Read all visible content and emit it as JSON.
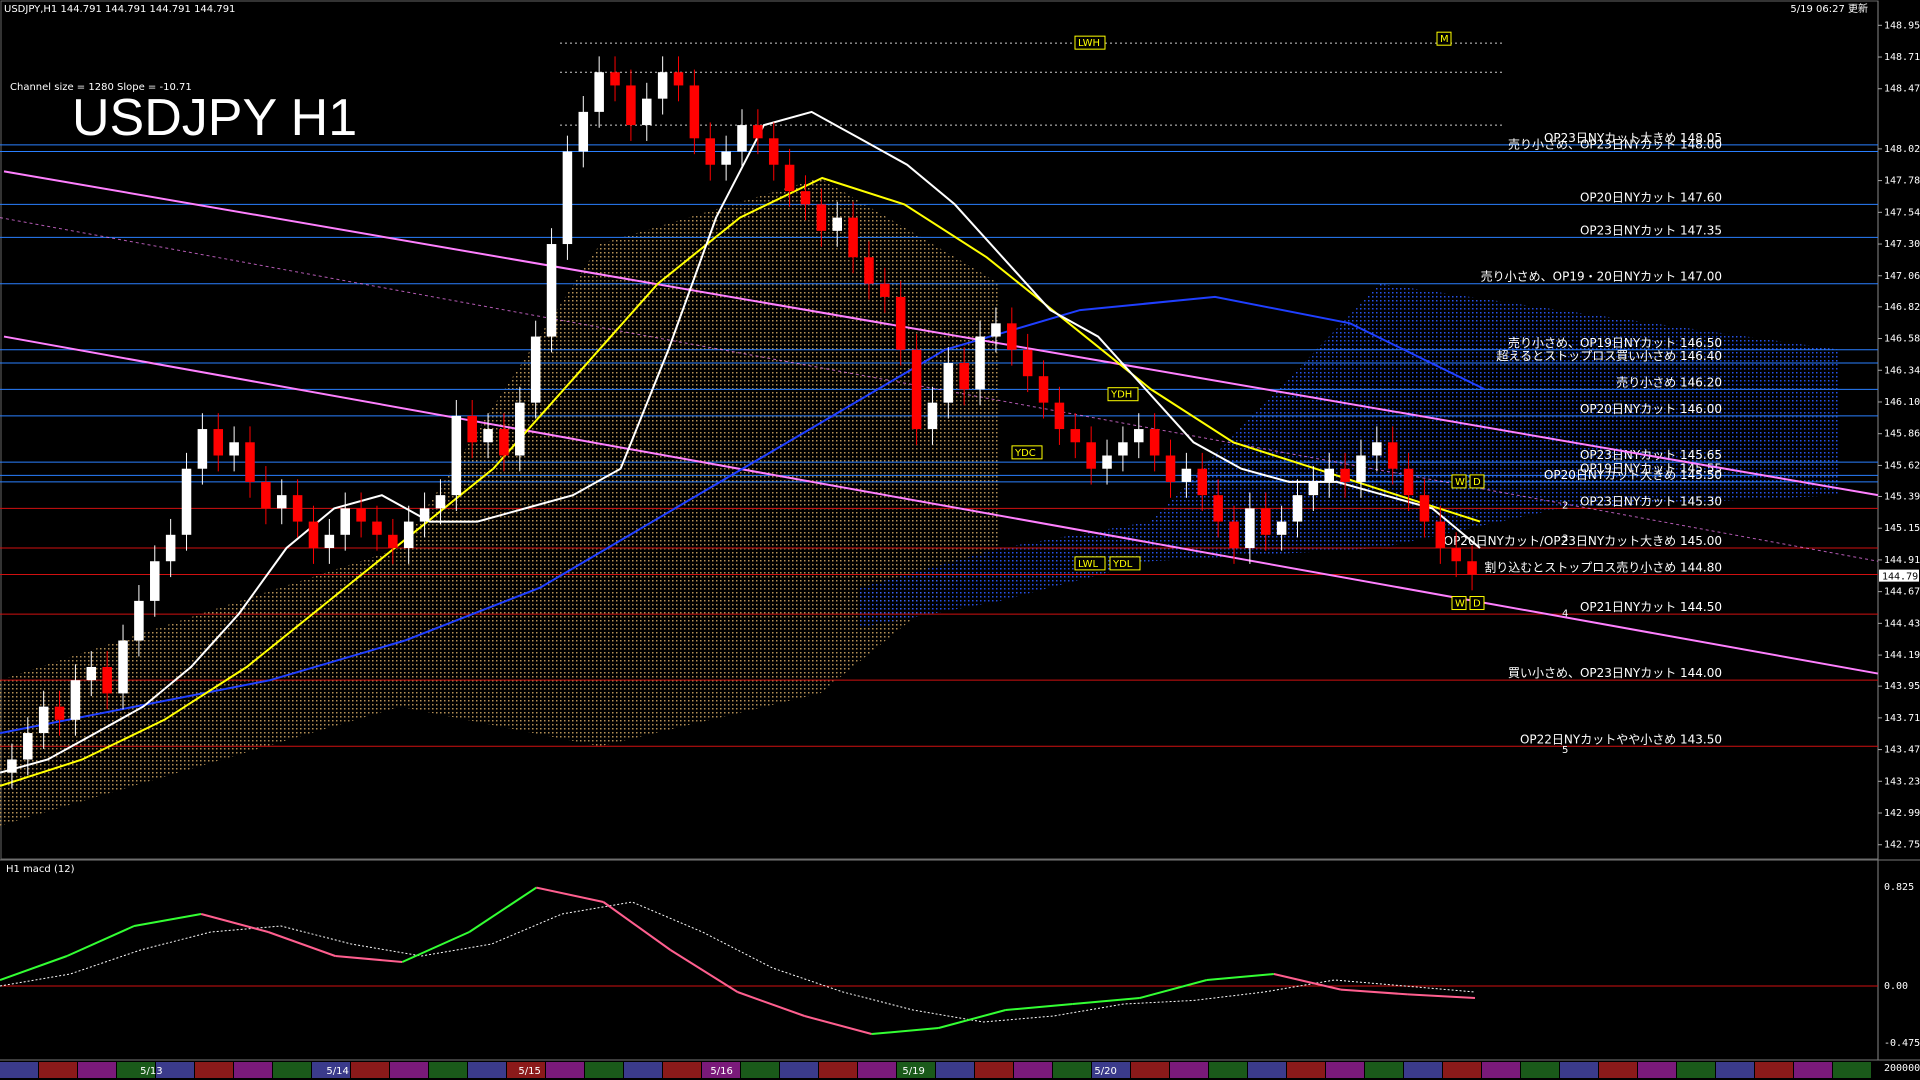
{
  "header": {
    "symbol_info": "USDJPY,H1  144.791 144.791 144.791 144.791",
    "updated": "5/19 06:27 更新",
    "channel_info": "Channel size = 1280 Slope = -10.71",
    "big_title": "USDJPY H1"
  },
  "colors": {
    "background": "#000000",
    "bull_candle": "#ffffff",
    "bear_candle": "#ff0000",
    "ma_white": "#ffffff",
    "ma_yellow": "#ffff00",
    "ma_blue": "#1f3fff",
    "channel": "#ff80ff",
    "cloud_lead_a": "#c8a060",
    "cloud_lead_b": "#2a5aff",
    "order_line_blue": "#2a7fff",
    "order_line_red": "#d01010",
    "macd_up": "#33ff33",
    "macd_down": "#ff5f8f",
    "bollinger": "#d01010",
    "chikou": "#22bb22"
  },
  "chart_data": {
    "type": "candlestick",
    "title": "USDJPY H1",
    "ylim": [
      142.7,
      148.98
    ],
    "y_ticks": [
      148.955,
      148.715,
      148.475,
      148.02,
      147.78,
      147.54,
      147.3,
      147.06,
      146.825,
      146.585,
      146.345,
      146.105,
      145.865,
      145.625,
      145.39,
      145.15,
      144.91,
      144.67,
      144.43,
      144.19,
      143.955,
      143.715,
      143.475,
      143.235,
      142.995,
      142.755
    ],
    "last_price": "144.791",
    "date_labels": [
      "5/13",
      "5/14",
      "5/15",
      "5/16",
      "5/19",
      "5/20"
    ],
    "date_positions": [
      0.058,
      0.155,
      0.255,
      0.355,
      0.455,
      0.555
    ],
    "candles_close": [
      143.4,
      143.6,
      143.8,
      143.7,
      144.0,
      144.1,
      143.9,
      144.3,
      144.6,
      144.9,
      145.1,
      145.6,
      145.9,
      145.7,
      145.8,
      145.5,
      145.3,
      145.4,
      145.2,
      145.0,
      145.1,
      145.3,
      145.2,
      145.1,
      145.0,
      145.2,
      145.3,
      145.4,
      146.0,
      145.8,
      145.9,
      145.7,
      146.1,
      146.6,
      147.3,
      148.0,
      148.3,
      148.6,
      148.5,
      148.2,
      148.4,
      148.6,
      148.5,
      148.1,
      147.9,
      148.0,
      148.2,
      148.1,
      147.9,
      147.7,
      147.6,
      147.4,
      147.5,
      147.2,
      147.0,
      146.9,
      146.5,
      145.9,
      146.1,
      146.4,
      146.2,
      146.6,
      146.7,
      146.5,
      146.3,
      146.1,
      145.9,
      145.8,
      145.6,
      145.7,
      145.8,
      145.9,
      145.7,
      145.5,
      145.6,
      145.4,
      145.2,
      145.0,
      145.3,
      145.1,
      145.2,
      145.4,
      145.5,
      145.6,
      145.5,
      145.7,
      145.8,
      145.6,
      145.4,
      145.2,
      145.0,
      144.9,
      144.8
    ],
    "ma_white": [
      143.3,
      143.4,
      143.6,
      143.8,
      144.1,
      144.5,
      145.0,
      145.3,
      145.4,
      145.2,
      145.2,
      145.3,
      145.4,
      145.6,
      146.5,
      147.5,
      148.2,
      148.3,
      148.1,
      147.9,
      147.6,
      147.2,
      146.8,
      146.6,
      146.2,
      145.8,
      145.6,
      145.5,
      145.5,
      145.4,
      145.3,
      145.0
    ],
    "ma_yellow": [
      143.2,
      143.4,
      143.7,
      144.1,
      144.6,
      145.1,
      145.6,
      146.3,
      147.0,
      147.5,
      147.8,
      147.6,
      147.2,
      146.7,
      146.2,
      145.8,
      145.6,
      145.4,
      145.2
    ],
    "ma_blue": [
      143.6,
      143.8,
      144.0,
      144.3,
      144.7,
      145.3,
      145.9,
      146.5,
      146.8,
      146.9,
      146.7,
      146.2
    ],
    "macd": [
      0.05,
      0.25,
      0.5,
      0.6,
      0.45,
      0.25,
      0.2,
      0.45,
      0.82,
      0.7,
      0.3,
      -0.05,
      -0.25,
      -0.4,
      -0.35,
      -0.2,
      -0.15,
      -0.1,
      0.05,
      0.1,
      -0.03,
      -0.07,
      -0.1
    ],
    "macd_signal": [
      0.0,
      0.1,
      0.3,
      0.45,
      0.5,
      0.35,
      0.25,
      0.35,
      0.6,
      0.7,
      0.45,
      0.15,
      -0.05,
      -0.2,
      -0.3,
      -0.25,
      -0.15,
      -0.12,
      -0.05,
      0.05,
      0.0,
      -0.05
    ],
    "macd_label": "H1  macd (12)",
    "macd_ticks": [
      "0.825",
      "0.00",
      "-0.475",
      "200000"
    ],
    "channel_lines": [
      {
        "from": [
          0.0,
          147.85
        ],
        "to": [
          1.0,
          145.4
        ]
      },
      {
        "from": [
          0.0,
          146.6
        ],
        "to": [
          1.0,
          144.05
        ]
      }
    ],
    "order_levels": [
      {
        "price": 148.05,
        "label": "OP23日NYカット大きめ 148.05",
        "color": "blue"
      },
      {
        "price": 148.0,
        "label": "売り小さめ、OP23日NYカット 148.00",
        "color": "blue"
      },
      {
        "price": 147.6,
        "label": "OP20日NYカット 147.60",
        "color": "blue"
      },
      {
        "price": 147.35,
        "label": "OP23日NYカット 147.35",
        "color": "blue"
      },
      {
        "price": 147.0,
        "label": "売り小さめ、OP19・20日NYカット 147.00",
        "color": "blue"
      },
      {
        "price": 146.5,
        "label": "売り小さめ、OP19日NYカット 146.50",
        "color": "blue"
      },
      {
        "price": 146.4,
        "label": "超えるとストップロス買い小さめ 146.40",
        "color": "blue"
      },
      {
        "price": 146.2,
        "label": "売り小さめ 146.20",
        "color": "blue"
      },
      {
        "price": 146.0,
        "label": "OP20日NYカット 146.00",
        "color": "blue"
      },
      {
        "price": 145.65,
        "label": "OP23日NYカット 145.65",
        "color": "blue"
      },
      {
        "price": 145.55,
        "label": "OP19日NYカット 145.55",
        "color": "blue"
      },
      {
        "price": 145.5,
        "label": "OP20日NYカット大きめ 145.50",
        "color": "blue"
      },
      {
        "price": 145.3,
        "label": "OP23日NYカット 145.30",
        "color": "red"
      },
      {
        "price": 145.0,
        "label": "OP20日NYカット/OP23日NYカット大きめ 145.00",
        "color": "red"
      },
      {
        "price": 144.8,
        "label": "割り込むとストップロス売り小さめ 144.80",
        "color": "red"
      },
      {
        "price": 144.5,
        "label": "OP21日NYカット 144.50",
        "color": "red"
      },
      {
        "price": 144.0,
        "label": "買い小さめ、OP23日NYカット 144.00",
        "color": "red"
      },
      {
        "price": 143.5,
        "label": "OP22日NYカットやや小さめ 143.50",
        "color": "red"
      }
    ],
    "markers": [
      {
        "text": "LWH",
        "price": 148.82
      },
      {
        "text": "YDH",
        "price": 146.16
      },
      {
        "text": "YDC",
        "price": 145.72
      },
      {
        "text": "LWL",
        "price": 144.88
      },
      {
        "text": "YDL",
        "price": 144.88
      },
      {
        "text": "W",
        "price": 145.5
      },
      {
        "text": "D",
        "price": 145.5
      },
      {
        "text": "W",
        "price": 144.58
      },
      {
        "text": "D",
        "price": 144.58
      },
      {
        "text": "M",
        "price": 148.85
      }
    ],
    "wave_labels": [
      "2",
      "3",
      "4",
      "5"
    ]
  }
}
